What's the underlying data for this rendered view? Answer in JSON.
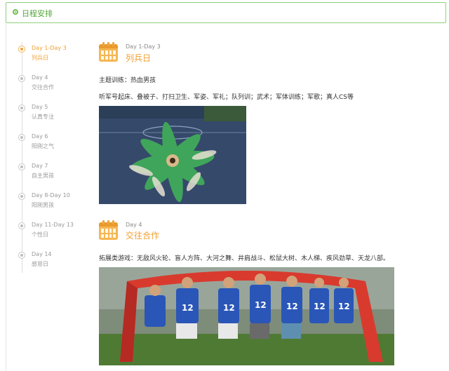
{
  "header": {
    "title": "日程安排"
  },
  "nav": {
    "items": [
      {
        "day": "Day 1-Day 3",
        "name": "列兵日",
        "active": true
      },
      {
        "day": "Day 4",
        "name": "交往合作"
      },
      {
        "day": "Day 5",
        "name": "认真专注"
      },
      {
        "day": "Day 6",
        "name": "阳刚之气"
      },
      {
        "day": "Day 7",
        "name": "自主男孩"
      },
      {
        "day": "Day 8-Day 10",
        "name": "阳刚男孩"
      },
      {
        "day": "Day 11-Day 13",
        "name": "个性日"
      },
      {
        "day": "Day 14",
        "name": "感恩日"
      }
    ]
  },
  "sections": [
    {
      "day": "Day 1-Day 3",
      "title": "列兵日",
      "theme": "主题训练：热血男孩",
      "detail": "听军号起床、叠被子、打扫卫生、军姿、军礼；队列训；武术；军体训练；军歌；真人CS等"
    },
    {
      "day": "Day 4",
      "title": "交往合作",
      "detail": "拓展类游戏：无敌风火轮、盲人方阵、大河之舞、井肩战斗、松鼠大树、木人梯、疾风劲草、天龙八部。"
    }
  ],
  "colors": {
    "accent": "#f0a030",
    "header_green": "#55a83a"
  },
  "icons": {
    "section_icon": "calendar-icon",
    "header_icon": "circle-dot-icon"
  }
}
